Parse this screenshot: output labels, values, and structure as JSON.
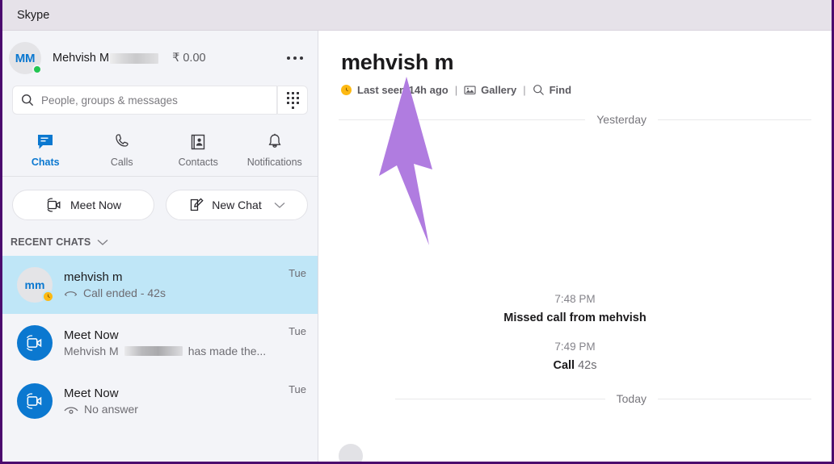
{
  "window": {
    "title": "Skype"
  },
  "sidebar": {
    "profile": {
      "initials": "MM",
      "name_prefix": "Mehvish M",
      "name_suffix": "",
      "balance": "₹ 0.00",
      "more_label": "More options",
      "presence": "online"
    },
    "search": {
      "placeholder": "People, groups & messages",
      "value": "",
      "dialpad_label": "Dial pad"
    },
    "tabs": [
      {
        "label": "Chats",
        "icon": "chat-icon",
        "active": true
      },
      {
        "label": "Calls",
        "icon": "phone-icon",
        "active": false
      },
      {
        "label": "Contacts",
        "icon": "contacts-icon",
        "active": false
      },
      {
        "label": "Notifications",
        "icon": "bell-icon",
        "active": false
      }
    ],
    "actions": {
      "meet_now": "Meet Now",
      "new_chat": "New Chat"
    },
    "recent_chats_label": "RECENT CHATS",
    "chats": [
      {
        "avatar_text": "mm",
        "avatar_type": "initials",
        "name": "mehvish m",
        "preview": "Call ended - 42s",
        "preview_icon": "call-ended-icon",
        "time": "Tue",
        "selected": true,
        "status_badge": "away-clock"
      },
      {
        "avatar_text": "",
        "avatar_type": "meet",
        "name": "Meet Now",
        "preview_prefix": "Mehvish M",
        "preview_suffix": "has made the...",
        "preview_icon": "",
        "time": "Tue",
        "selected": false,
        "status_badge": ""
      },
      {
        "avatar_text": "",
        "avatar_type": "meet",
        "name": "Meet Now",
        "preview": "No answer",
        "preview_icon": "no-answer-icon",
        "time": "Tue",
        "selected": false,
        "status_badge": ""
      }
    ]
  },
  "conversation": {
    "title": "mehvish m",
    "last_seen": "Last seen 14h ago",
    "gallery_label": "Gallery",
    "find_label": "Find",
    "separator": "|",
    "dividers": {
      "yesterday": "Yesterday",
      "today": "Today"
    },
    "messages": [
      {
        "time": "7:48 PM",
        "text": "Missed call from mehvish",
        "duration": ""
      },
      {
        "time": "7:49 PM",
        "text": "Call",
        "duration": "42s"
      }
    ]
  },
  "annotation": {
    "type": "arrow",
    "color": "#b07ce0",
    "points_to": "Last seen 14h ago"
  },
  "colors": {
    "accent": "#0b78d0",
    "window_border": "#4b0a6e",
    "selected_chat": "#bfe6f7",
    "sidebar_bg": "#f3f4f8",
    "titlebar_bg": "#e6e2e9",
    "away": "#fdb913",
    "online": "#23c552"
  }
}
